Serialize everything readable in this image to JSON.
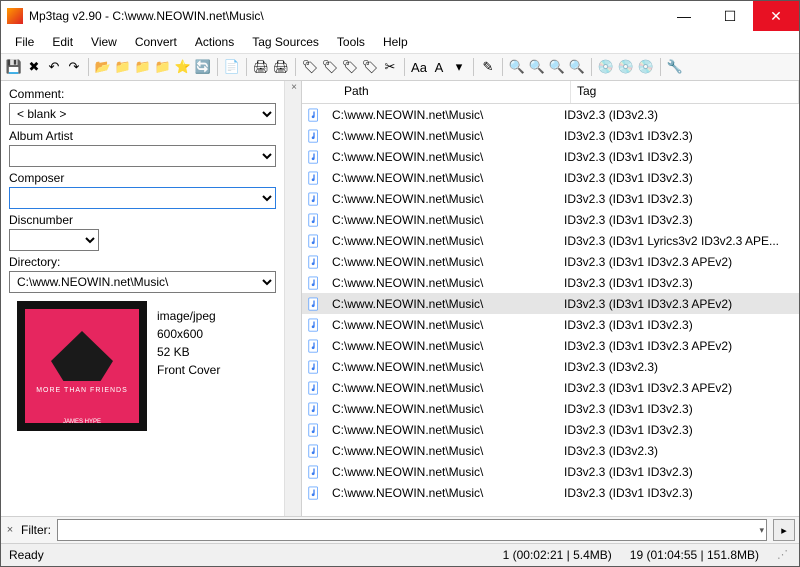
{
  "title": "Mp3tag v2.90  -  C:\\www.NEOWIN.net\\Music\\",
  "menu": [
    "File",
    "Edit",
    "View",
    "Convert",
    "Actions",
    "Tag Sources",
    "Tools",
    "Help"
  ],
  "fields": {
    "comment_label": "Comment:",
    "comment_value": "< blank >",
    "albumartist_label": "Album Artist",
    "albumartist_value": "",
    "composer_label": "Composer",
    "composer_value": "",
    "discnumber_label": "Discnumber",
    "discnumber_value": "",
    "directory_label": "Directory:",
    "directory_value": "C:\\www.NEOWIN.net\\Music\\"
  },
  "cover": {
    "mime": "image/jpeg",
    "dims": "600x600",
    "size": "52 KB",
    "type": "Front Cover",
    "art_text1": "MORE THAN FRIENDS",
    "art_text2": "JAMES HYPE"
  },
  "columns": {
    "path": "Path",
    "tag": "Tag"
  },
  "rows": [
    {
      "path": "C:\\www.NEOWIN.net\\Music\\",
      "tag": "ID3v2.3 (ID3v2.3)",
      "sel": false
    },
    {
      "path": "C:\\www.NEOWIN.net\\Music\\",
      "tag": "ID3v2.3 (ID3v1 ID3v2.3)",
      "sel": false
    },
    {
      "path": "C:\\www.NEOWIN.net\\Music\\",
      "tag": "ID3v2.3 (ID3v1 ID3v2.3)",
      "sel": false
    },
    {
      "path": "C:\\www.NEOWIN.net\\Music\\",
      "tag": "ID3v2.3 (ID3v1 ID3v2.3)",
      "sel": false
    },
    {
      "path": "C:\\www.NEOWIN.net\\Music\\",
      "tag": "ID3v2.3 (ID3v1 ID3v2.3)",
      "sel": false
    },
    {
      "path": "C:\\www.NEOWIN.net\\Music\\",
      "tag": "ID3v2.3 (ID3v1 ID3v2.3)",
      "sel": false
    },
    {
      "path": "C:\\www.NEOWIN.net\\Music\\",
      "tag": "ID3v2.3 (ID3v1 Lyrics3v2 ID3v2.3 APE...",
      "sel": false
    },
    {
      "path": "C:\\www.NEOWIN.net\\Music\\",
      "tag": "ID3v2.3 (ID3v1 ID3v2.3 APEv2)",
      "sel": false
    },
    {
      "path": "C:\\www.NEOWIN.net\\Music\\",
      "tag": "ID3v2.3 (ID3v1 ID3v2.3)",
      "sel": false
    },
    {
      "path": "C:\\www.NEOWIN.net\\Music\\",
      "tag": "ID3v2.3 (ID3v1 ID3v2.3 APEv2)",
      "sel": true
    },
    {
      "path": "C:\\www.NEOWIN.net\\Music\\",
      "tag": "ID3v2.3 (ID3v1 ID3v2.3)",
      "sel": false
    },
    {
      "path": "C:\\www.NEOWIN.net\\Music\\",
      "tag": "ID3v2.3 (ID3v1 ID3v2.3 APEv2)",
      "sel": false
    },
    {
      "path": "C:\\www.NEOWIN.net\\Music\\",
      "tag": "ID3v2.3 (ID3v2.3)",
      "sel": false
    },
    {
      "path": "C:\\www.NEOWIN.net\\Music\\",
      "tag": "ID3v2.3 (ID3v1 ID3v2.3 APEv2)",
      "sel": false
    },
    {
      "path": "C:\\www.NEOWIN.net\\Music\\",
      "tag": "ID3v2.3 (ID3v1 ID3v2.3)",
      "sel": false
    },
    {
      "path": "C:\\www.NEOWIN.net\\Music\\",
      "tag": "ID3v2.3 (ID3v1 ID3v2.3)",
      "sel": false
    },
    {
      "path": "C:\\www.NEOWIN.net\\Music\\",
      "tag": "ID3v2.3 (ID3v2.3)",
      "sel": false
    },
    {
      "path": "C:\\www.NEOWIN.net\\Music\\",
      "tag": "ID3v2.3 (ID3v1 ID3v2.3)",
      "sel": false
    },
    {
      "path": "C:\\www.NEOWIN.net\\Music\\",
      "tag": "ID3v2.3 (ID3v1 ID3v2.3)",
      "sel": false
    }
  ],
  "filter": {
    "label": "Filter:",
    "value": ""
  },
  "status": {
    "ready": "Ready",
    "sel": "1 (00:02:21 | 5.4MB)",
    "total": "19 (01:04:55 | 151.8MB)"
  },
  "toolbar_icons": [
    "save",
    "delete",
    "undo",
    "redo",
    "|",
    "folder-open",
    "folder-add",
    "folder-up",
    "folder-fav",
    "star",
    "refresh",
    "|",
    "list",
    "|",
    "print",
    "print-all",
    "|",
    "copy-tag-1",
    "copy-tag-2",
    "copy-tag-3",
    "copy-tag-4",
    "cut-tag",
    "|",
    "actions-1",
    "actions-2",
    "dd",
    "|",
    "edit",
    "|",
    "source-1",
    "source-2",
    "source-3",
    "source-4",
    "|",
    "disc-1",
    "disc-2",
    "disc-3",
    "|",
    "settings"
  ]
}
